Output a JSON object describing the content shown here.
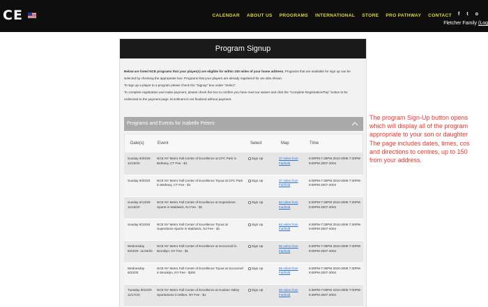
{
  "header": {
    "logo_text": "CE",
    "flag_icon": "us-flag-icon",
    "nav": [
      "CALENDAR",
      "ABOUT US",
      "PROGRAMS",
      "INTERNATIONAL",
      "STORE",
      "PRO PATHWAY",
      "CONTACT"
    ],
    "nav_color": "#e0d64a",
    "social": [
      "f",
      "t",
      "o"
    ],
    "user_name": "Fletcher Family",
    "user_link": "(Log"
  },
  "panel": {
    "title": "Program Signup",
    "intro_bold": "Below are listed NCE programs that your player(s) are eligible for within 150 miles of your home address.",
    "intro_rest": " Programs that are available for sign up can be selected by checking the appropriate box. Programs that your players are already registered for are also shown.",
    "instruction1": "To sign up a player to a program please check the \"Signup\" box under \"Select\".",
    "instruction2": "To complete registration and make payment, please check the box to confirm you have read our waiver and click the \"Complete Registration/Pay\" button to be redirected to the payment page. Enrollment is not finalized without payment.",
    "section_title": "Programs and Events for Isabelle Peters",
    "columns": [
      "Date(s)",
      "Event",
      "Select",
      "Map",
      "Time"
    ]
  },
  "rows": [
    {
      "date": "Sunday 9/20/20- 11/15/20",
      "event": "NCE NY Metro Fall Center of Excellence at CFC Park in Bethany, CT Fee - $1",
      "select": "Sign Up",
      "map": "37 miles from Fairfield",
      "time": "6:00PM-7:30PM 2010-2008 7:30PM-9:00PM 2007-2004"
    },
    {
      "date": "Sunday 9/20/20",
      "event": "NCE NY Metro Fall Center of Excellence Tryout at CFC Park in Bethany, CT Fee - $1",
      "select": "Sign Up",
      "map": "37 miles from Fairfield",
      "time": "6:00PM-7:30PM 2010-2008 7:30PM-9:00PM 2007-2004"
    },
    {
      "date": "Sunday 9/13/20- 11/15/20",
      "event": "NCE NY Metro Fall Center of Excellence at Superdome Sports in Waldwick, NJ Fee - $1",
      "select": "Sign Up",
      "map": "63 miles from Fairfield",
      "time": "6:00PM-7:30PM 2010-2008 7:30PM-9:00PM 2007-2004"
    },
    {
      "date": "Sunday 9/13/20",
      "event": "NCE NY Metro Fall Center of Excellence Tryout at Superdome Sports in Waldwick, NJ Fee - $1",
      "select": "Sign Up",
      "map": "63 miles from Fairfield",
      "time": "6:00PM-7:30PM 2010-2008 7:30PM-9:00PM 2007-2004"
    },
    {
      "date": "Wednesday 9/23/20- 11/18/20",
      "event": "NCE NY Metro Fall Center of Excellence at Socceroof in Brooklyn, NY Fee - $1",
      "select": "Sign Up",
      "map": "65 miles from Fairfield",
      "time": "6:00PM-7:30PM 2010-2008 7:30PM-9:00PM 2007-2004"
    },
    {
      "date": "Wednesday 9/23/20",
      "event": "NCE NY Metro Fall Center of Excellence Tryout at Socceroof in Brooklyn, NY Fee - $300",
      "select": "Sign Up",
      "map": "65 miles from Fairfield",
      "time": "6:00PM-7:30PM 2010-2008 7:30PM-9:00PM 2007-2004"
    },
    {
      "date": "Tuesday 9/22/20- 11/17/20",
      "event": "NCE NY Metro Fall Center of Excellence at Hudson Valley Sportsdome in Milton, NY Fee - $1",
      "select": "Sign Up",
      "map": "69 miles from Fairfield",
      "time": "5:30PM-7:00PM 2010-2008 7:00PM-8:30PM 2007-2004"
    }
  ],
  "annotation": [
    "The program Sign-Up button opens",
    "which will display all of the program",
    "appropriate to your son or daughter",
    "The page includes dates, times, cos",
    "and directions to centres, up to 150",
    "from your address."
  ],
  "colors": {
    "annotation": "#e8332d",
    "link": "#2a6fd6",
    "header_bg": "#0e0e0e"
  }
}
